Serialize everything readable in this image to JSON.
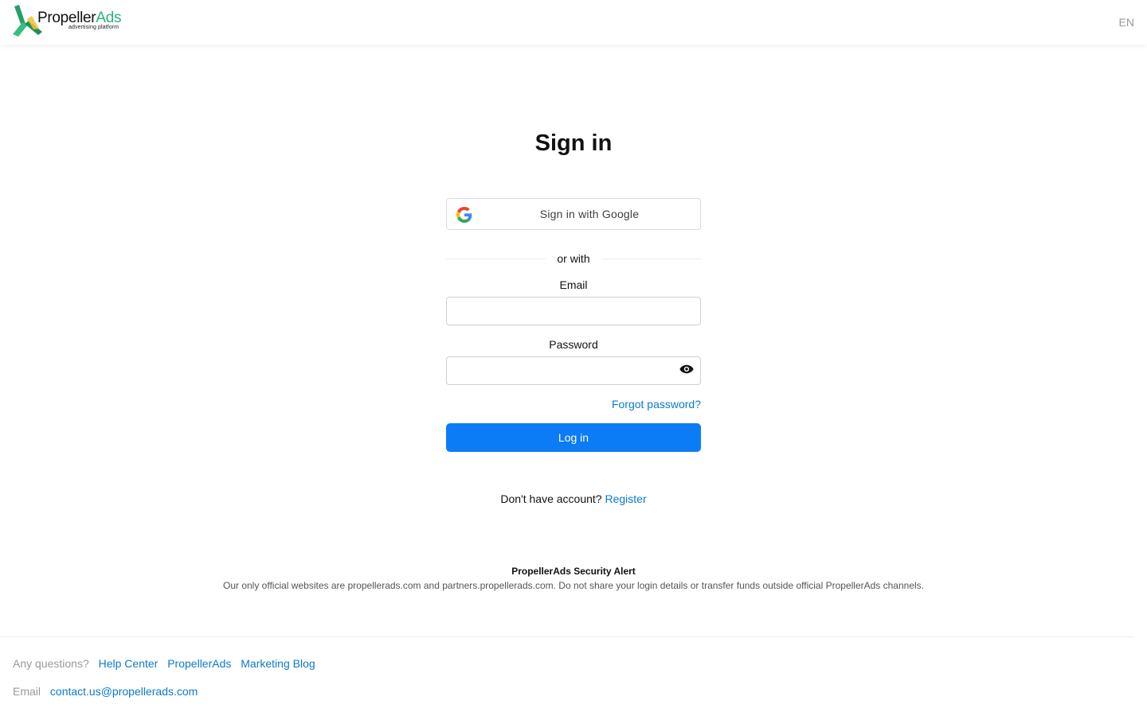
{
  "header": {
    "brand_part1": "Propeller",
    "brand_part2": "Ads",
    "brand_tagline": "advertising platform",
    "language": "EN"
  },
  "page": {
    "title": "Sign in"
  },
  "google": {
    "label": "Sign in with Google",
    "icon": "google-g-icon"
  },
  "divider": {
    "text": "or with"
  },
  "form": {
    "email_label": "Email",
    "email_value": "",
    "password_label": "Password",
    "password_value": "",
    "show_password_icon": "eye-icon",
    "forgot_link": "Forgot password?",
    "login_button": "Log in"
  },
  "register": {
    "prompt": "Don't have account?",
    "link": "Register"
  },
  "security": {
    "title": "PropellerAds Security Alert",
    "body": "Our only official websites are propellerads.com and partners.propellerads.com. Do not share your login details or transfer funds outside official PropellerAds channels."
  },
  "footer": {
    "questions_label": "Any questions?",
    "links": [
      "Help Center",
      "PropellerAds",
      "Marketing Blog"
    ],
    "email_label": "Email",
    "email_link": "contact.us@propellerads.com"
  },
  "colors": {
    "primary": "#0b7cf5",
    "link": "#0a7ad1",
    "brand_green": "#26b37a"
  }
}
